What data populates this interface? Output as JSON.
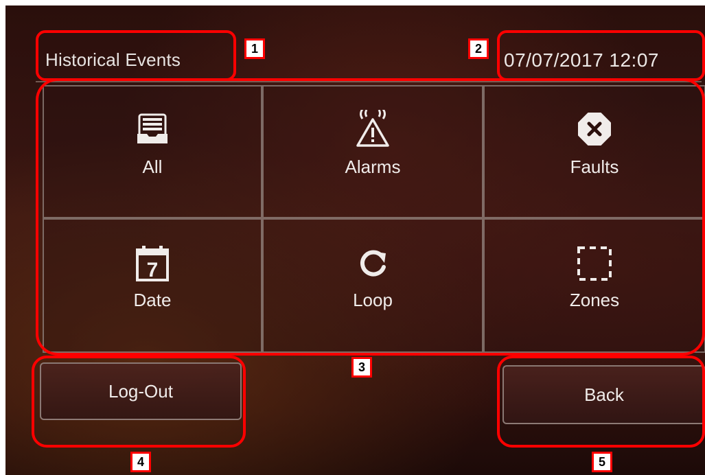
{
  "header": {
    "title": "Historical Events",
    "datetime": "07/07/2017 12:07"
  },
  "tiles": [
    {
      "label": "All",
      "icon": "inbox-tray-icon"
    },
    {
      "label": "Alarms",
      "icon": "alarm-warning-icon"
    },
    {
      "label": "Faults",
      "icon": "fault-octagon-x-icon"
    },
    {
      "label": "Date",
      "icon": "calendar-icon"
    },
    {
      "label": "Loop",
      "icon": "loop-refresh-icon"
    },
    {
      "label": "Zones",
      "icon": "zones-dashed-square-icon"
    }
  ],
  "calendar_day": "7",
  "buttons": {
    "logout": "Log-Out",
    "back": "Back"
  },
  "annotations": {
    "markers": [
      "1",
      "2",
      "3",
      "4",
      "5"
    ],
    "color": "#ff0000"
  }
}
